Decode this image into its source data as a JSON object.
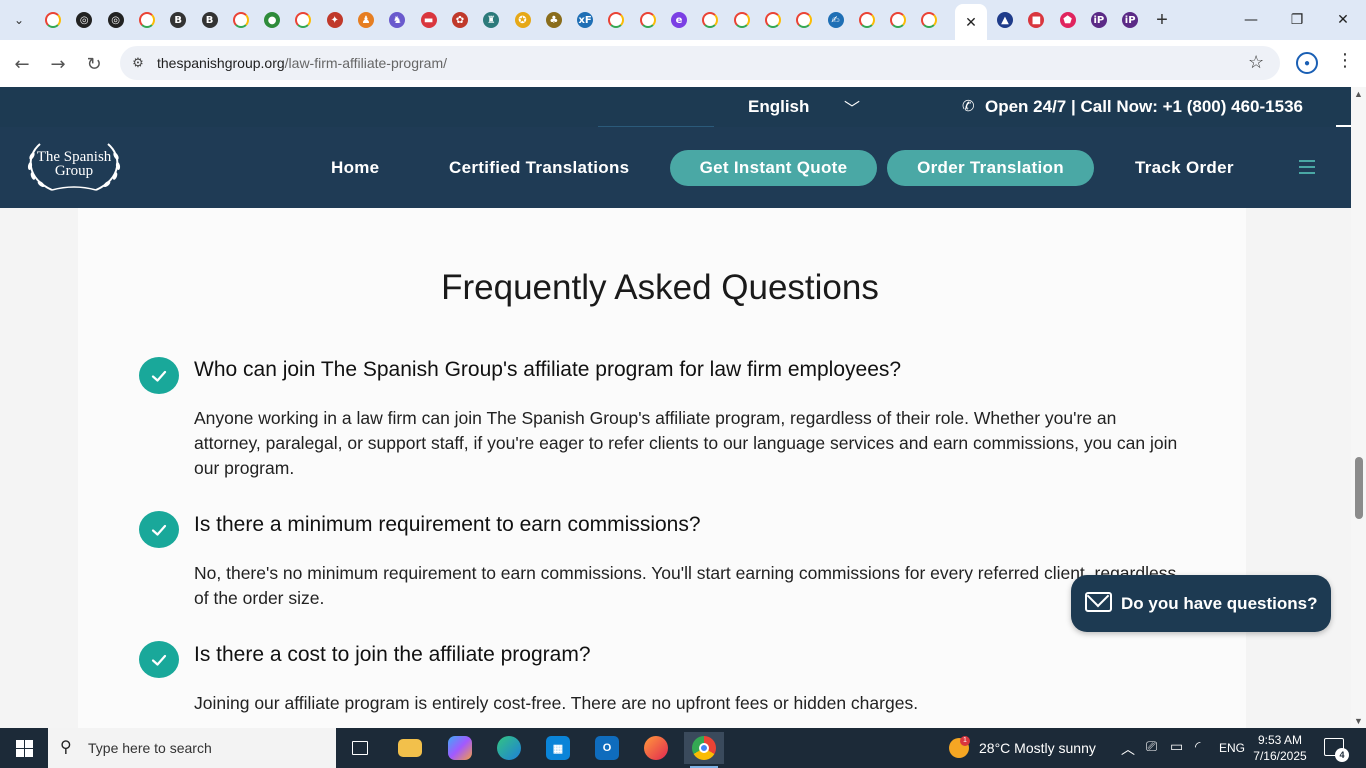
{
  "browser": {
    "tabs": [
      {
        "icon": "google-icon",
        "color": "#4285f4"
      },
      {
        "icon": "openai-icon",
        "color": "#222222",
        "glyph": "◎"
      },
      {
        "icon": "openai-icon",
        "color": "#222222",
        "glyph": "◎"
      },
      {
        "icon": "google-icon",
        "color": "#4285f4"
      },
      {
        "icon": "bold-b-icon",
        "color": "#333333",
        "glyph": "B"
      },
      {
        "icon": "bold-b-icon",
        "color": "#333333",
        "glyph": "B"
      },
      {
        "icon": "google-icon",
        "color": "#4285f4"
      },
      {
        "icon": "green-globe-icon",
        "color": "#2e8b3a",
        "glyph": "●"
      },
      {
        "icon": "google-icon",
        "color": "#4285f4"
      },
      {
        "icon": "star-badge-icon",
        "color": "#c0392b",
        "glyph": "✦"
      },
      {
        "icon": "figure-icon",
        "color": "#e67e22",
        "glyph": "♟"
      },
      {
        "icon": "game-icon",
        "color": "#6a5acd",
        "glyph": "♞"
      },
      {
        "icon": "red-bar-icon",
        "color": "#d9363e",
        "glyph": "▬"
      },
      {
        "icon": "sticker-icon",
        "color": "#c0392b",
        "glyph": "✿"
      },
      {
        "icon": "figure-icon",
        "color": "#2c7a7b",
        "glyph": "♜"
      },
      {
        "icon": "badge-icon",
        "color": "#e6a817",
        "glyph": "✪"
      },
      {
        "icon": "pineapple-icon",
        "color": "#8a6d1c",
        "glyph": "♣"
      },
      {
        "icon": "xf-icon",
        "color": "#1f6fb5",
        "glyph": "xF"
      },
      {
        "icon": "google-icon",
        "color": "#4285f4"
      },
      {
        "icon": "google-icon",
        "color": "#4285f4"
      },
      {
        "icon": "e-circle-icon",
        "color": "#7b3fe4",
        "glyph": "e"
      },
      {
        "icon": "google-icon",
        "color": "#4285f4"
      },
      {
        "icon": "google-icon",
        "color": "#4285f4"
      },
      {
        "icon": "google-icon",
        "color": "#4285f4"
      },
      {
        "icon": "google-icon",
        "color": "#4285f4"
      },
      {
        "icon": "signature-icon",
        "color": "#1f6fb5",
        "glyph": "✍"
      },
      {
        "icon": "google-icon",
        "color": "#4285f4"
      },
      {
        "icon": "google-icon",
        "color": "#4285f4"
      },
      {
        "icon": "google-icon",
        "color": "#4285f4"
      }
    ],
    "tabs_after": [
      {
        "icon": "triangle-logo-icon",
        "color": "#1f3b8a",
        "glyph": "▲"
      },
      {
        "icon": "red-square-icon",
        "color": "#d9363e",
        "glyph": "■"
      },
      {
        "icon": "red-shield-icon",
        "color": "#e0245e",
        "glyph": "⬟"
      },
      {
        "icon": "ip-icon",
        "color": "#5b2a86",
        "glyph": "iP"
      },
      {
        "icon": "ip-icon",
        "color": "#5b2a86",
        "glyph": "iP"
      }
    ],
    "url_host": "thespanishgroup.org",
    "url_path": "/law-firm-affiliate-program/"
  },
  "site": {
    "language": "English",
    "phone": "Open 24/7 | Call Now:  +1 (800) 460-1536",
    "logo_line1": "The Spanish",
    "logo_line2": "Group",
    "nav": {
      "home": "Home",
      "certified": "Certified Translations",
      "quote": "Get Instant Quote",
      "order": "Order Translation",
      "track": "Track Order"
    },
    "accent": "#4aa8a5",
    "navy": "#1f3b55"
  },
  "faq": {
    "title": "Frequently Asked Questions",
    "items": [
      {
        "q": "Who can join The Spanish Group's affiliate program for law firm employees?",
        "a": "Anyone working in a law firm can join The Spanish Group's affiliate program, regardless of their role. Whether you're an attorney, paralegal, or support staff, if you're eager to refer clients to our language services and earn commissions, you can join our program."
      },
      {
        "q": "Is there a minimum requirement to earn commissions?",
        "a": "No, there's no minimum requirement to earn commissions. You'll start earning commissions for every referred client, regardless of the order size."
      },
      {
        "q": "Is there a cost to join the affiliate program?",
        "a": "Joining our affiliate program is entirely cost-free. There are no upfront fees or hidden charges."
      }
    ]
  },
  "chat": {
    "label": "Do you have questions?"
  },
  "taskbar": {
    "search_placeholder": "Type here to search",
    "weather_badge": "1",
    "weather": "28°C  Mostly sunny",
    "lang": "ENG",
    "time": "9:53 AM",
    "date": "7/16/2025",
    "notifications": "4"
  }
}
